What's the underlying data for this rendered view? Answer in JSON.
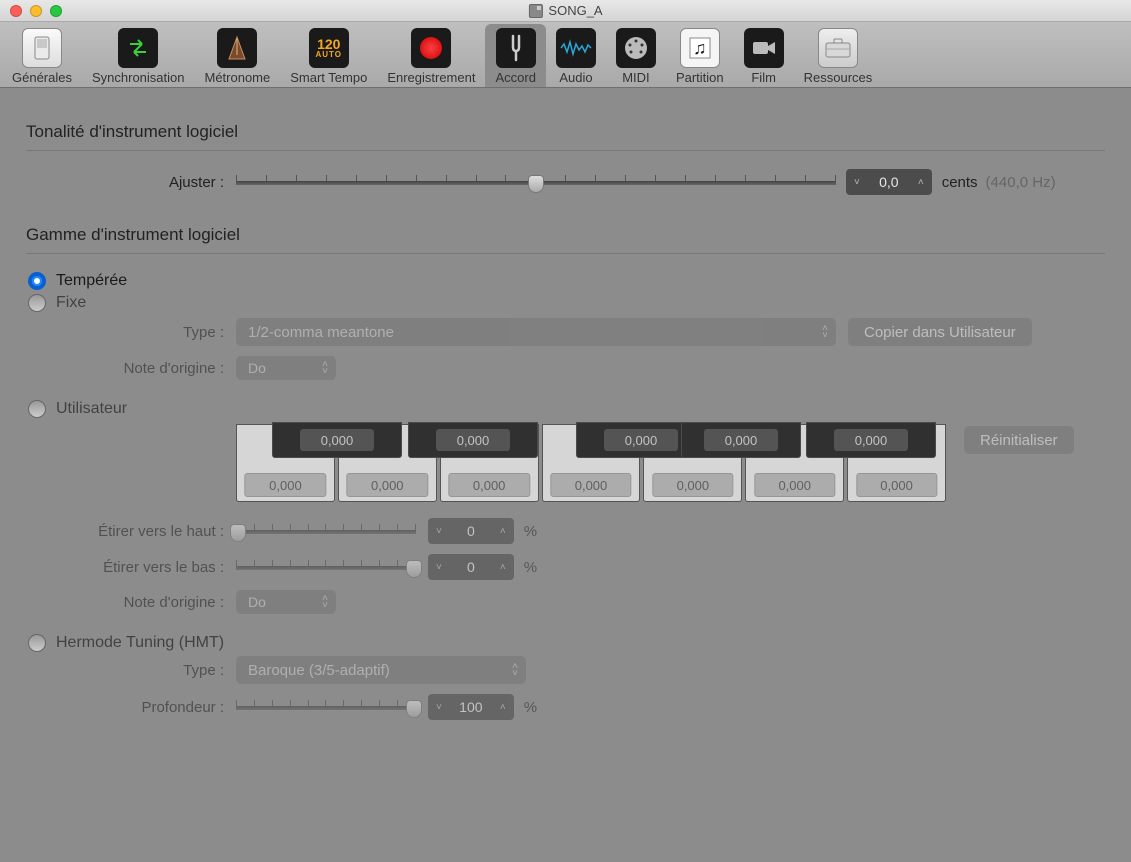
{
  "window": {
    "title": "SONG_A"
  },
  "toolbar": {
    "items": [
      {
        "label": "Générales",
        "icon": "switch"
      },
      {
        "label": "Synchronisation",
        "icon": "sync"
      },
      {
        "label": "Métronome",
        "icon": "metronome"
      },
      {
        "label": "Smart Tempo",
        "icon": "tempo",
        "tempo_top": "120",
        "tempo_bottom": "AUTO"
      },
      {
        "label": "Enregistrement",
        "icon": "record"
      },
      {
        "label": "Accord",
        "icon": "tuning",
        "active": true
      },
      {
        "label": "Audio",
        "icon": "audio"
      },
      {
        "label": "MIDI",
        "icon": "midi"
      },
      {
        "label": "Partition",
        "icon": "score"
      },
      {
        "label": "Film",
        "icon": "film"
      },
      {
        "label": "Ressources",
        "icon": "resources"
      }
    ]
  },
  "tuning": {
    "section_title": "Tonalité d'instrument logiciel",
    "adjust_label": "Ajuster :",
    "adjust_value": "0,0",
    "adjust_unit": "cents",
    "adjust_freq": "(440,0 Hz)"
  },
  "scale": {
    "section_title": "Gamme d'instrument logiciel",
    "radio_tempered": "Tempérée",
    "radio_fixed": "Fixe",
    "type_label": "Type :",
    "type_value": "1/2-comma meantone",
    "copy_user": "Copier dans Utilisateur",
    "root_label": "Note d'origine :",
    "root_value": "Do",
    "radio_user": "Utilisateur",
    "reset": "Réinitialiser",
    "black_values": [
      "0,000",
      "0,000",
      "0,000",
      "0,000",
      "0,000"
    ],
    "white_values": [
      "0,000",
      "0,000",
      "0,000",
      "0,000",
      "0,000",
      "0,000",
      "0,000"
    ],
    "stretch_up_label": "Étirer vers le haut :",
    "stretch_up_value": "0",
    "stretch_down_label": "Étirer vers le bas :",
    "stretch_down_value": "0",
    "pct_unit": "%",
    "root2_label": "Note d'origine :",
    "root2_value": "Do",
    "radio_hmt": "Hermode Tuning (HMT)",
    "hmt_type_label": "Type :",
    "hmt_type_value": "Baroque (3/5-adaptif)",
    "depth_label": "Profondeur :",
    "depth_value": "100"
  }
}
